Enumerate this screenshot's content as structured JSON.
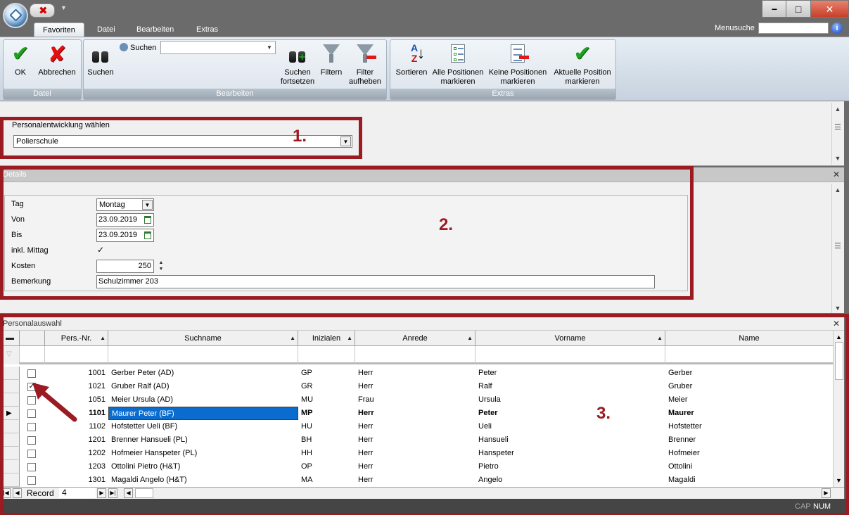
{
  "window": {
    "minimize_glyph": "−",
    "maximize_glyph": "□",
    "close_glyph": "✕",
    "qat_close_glyph": "✖",
    "qat_more_glyph": "▼"
  },
  "ribbon_tabs": [
    "Favoriten",
    "Datei",
    "Bearbeiten",
    "Extras"
  ],
  "menusuche": {
    "label": "Menusuche",
    "value": "",
    "help_glyph": "i"
  },
  "ribbon": {
    "datei": {
      "title": "Datei",
      "ok": "OK",
      "abbrechen": "Abbrechen"
    },
    "bearbeiten": {
      "title": "Bearbeiten",
      "suchen": "Suchen",
      "suchen_small": "Suchen",
      "suchen_combo_value": "",
      "suchen_fortsetzen_1": "Suchen",
      "suchen_fortsetzen_2": "fortsetzen",
      "filtern": "Filtern",
      "filter_aufheben_1": "Filter",
      "filter_aufheben_2": "aufheben"
    },
    "extras": {
      "title": "Extras",
      "sortieren": "Sortieren",
      "alle_1": "Alle Positionen",
      "alle_2": "markieren",
      "keine_1": "Keine Positionen",
      "keine_2": "markieren",
      "aktuelle_1": "Aktuelle Position",
      "aktuelle_2": "markieren"
    }
  },
  "personalentwicklung": {
    "label": "Personalentwicklung wählen",
    "value": "Polierschule"
  },
  "details": {
    "title": "Details",
    "tag_label": "Tag",
    "tag_value": "Montag",
    "von_label": "Von",
    "von_value": "23.09.2019",
    "bis_label": "Bis",
    "bis_value": "23.09.2019",
    "mittag_label": "inkl. Mittag",
    "mittag_checked": "✓",
    "kosten_label": "Kosten",
    "kosten_value": "250",
    "bemerkung_label": "Bemerkung",
    "bemerkung_value": "Schulzimmer 203"
  },
  "grid": {
    "title": "Personalauswahl",
    "columns": [
      "Pers.-Nr.",
      "Suchname",
      "Inizialen",
      "Anrede",
      "Vorname",
      "Name"
    ],
    "rows": [
      {
        "nr": "1001",
        "suchname": "Gerber Peter (AD)",
        "init": "GP",
        "anrede": "Herr",
        "vorname": "Peter",
        "name": "Gerber",
        "checked": ""
      },
      {
        "nr": "1021",
        "suchname": "Gruber Ralf (AD)",
        "init": "GR",
        "anrede": "Herr",
        "vorname": "Ralf",
        "name": "Gruber",
        "checked": "✓"
      },
      {
        "nr": "1051",
        "suchname": "Meier Ursula (AD)",
        "init": "MU",
        "anrede": "Frau",
        "vorname": "Ursula",
        "name": "Meier",
        "checked": ""
      },
      {
        "nr": "1101",
        "suchname": "Maurer Peter (BF)",
        "init": "MP",
        "anrede": "Herr",
        "vorname": "Peter",
        "name": "Maurer",
        "checked": ""
      },
      {
        "nr": "1102",
        "suchname": "Hofstetter Ueli (BF)",
        "init": "HU",
        "anrede": "Herr",
        "vorname": "Ueli",
        "name": "Hofstetter",
        "checked": ""
      },
      {
        "nr": "1201",
        "suchname": "Brenner Hansueli (PL)",
        "init": "BH",
        "anrede": "Herr",
        "vorname": "Hansueli",
        "name": "Brenner",
        "checked": ""
      },
      {
        "nr": "1202",
        "suchname": "Hofmeier Hanspeter (PL)",
        "init": "HH",
        "anrede": "Herr",
        "vorname": "Hanspeter",
        "name": "Hofmeier",
        "checked": ""
      },
      {
        "nr": "1203",
        "suchname": "Ottolini Pietro (H&T)",
        "init": "OP",
        "anrede": "Herr",
        "vorname": "Pietro",
        "name": "Ottolini",
        "checked": ""
      },
      {
        "nr": "1301",
        "suchname": "Magaldi Angelo (H&T)",
        "init": "MA",
        "anrede": "Herr",
        "vorname": "Angelo",
        "name": "Magaldi",
        "checked": ""
      }
    ],
    "current_row_index": 3,
    "record_label": "Record",
    "record_value": "4"
  },
  "status": {
    "cap": "CAP",
    "num": "NUM"
  },
  "annotations": {
    "one": "1.",
    "two": "2.",
    "three": "3."
  },
  "colors": {
    "accent": "#9b1b22",
    "selection": "#0a6cce"
  }
}
